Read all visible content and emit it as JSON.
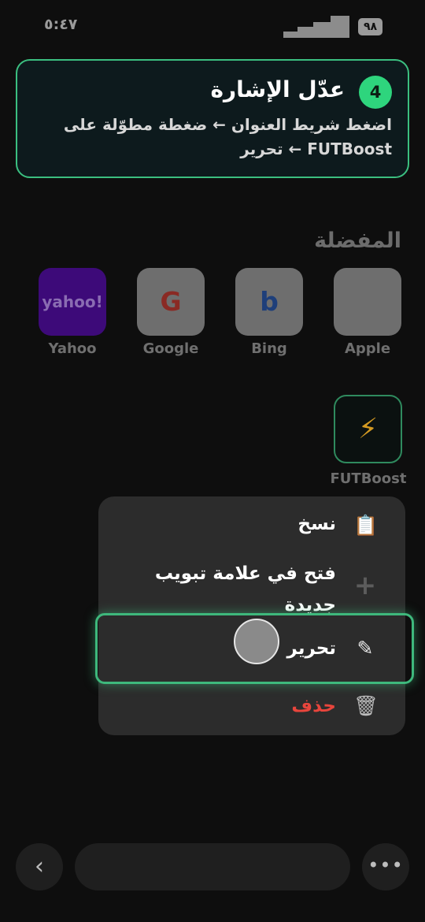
{
  "status_bar": {
    "time": "٥:٤٧",
    "battery": "٩٨"
  },
  "tip": {
    "step": "4",
    "title": "عدّل الإشارة",
    "body": "اضغط شريط العنوان ← ضغطة مطوّلة على FUTBoost ← تحرير"
  },
  "favorites": {
    "heading": "المفضلة",
    "items": [
      {
        "label": "Apple",
        "tile_text": ""
      },
      {
        "label": "Bing",
        "tile_text": "b"
      },
      {
        "label": "Google",
        "tile_text": "G"
      },
      {
        "label": "Yahoo",
        "tile_text": "yahoo!"
      }
    ],
    "futboost": {
      "label": "FUTBoost",
      "icon": "lightning-icon"
    }
  },
  "context_menu": {
    "items": [
      {
        "label": "نسخ",
        "icon": "clipboard-icon"
      },
      {
        "label": "فتح في علامة تبويب جديدة",
        "icon": "plus-icon"
      },
      {
        "label": "تحرير",
        "icon": "pencil-icon"
      },
      {
        "label": "حذف",
        "icon": "trash-icon",
        "color": "#e8453c"
      }
    ]
  },
  "colors": {
    "accent": "#2ed57d",
    "highlight": "#3eb87c",
    "destructive": "#e8453c"
  },
  "bottom_bar": {
    "back_icon": "chevron-left-icon",
    "more_icon": "ellipsis-icon"
  }
}
